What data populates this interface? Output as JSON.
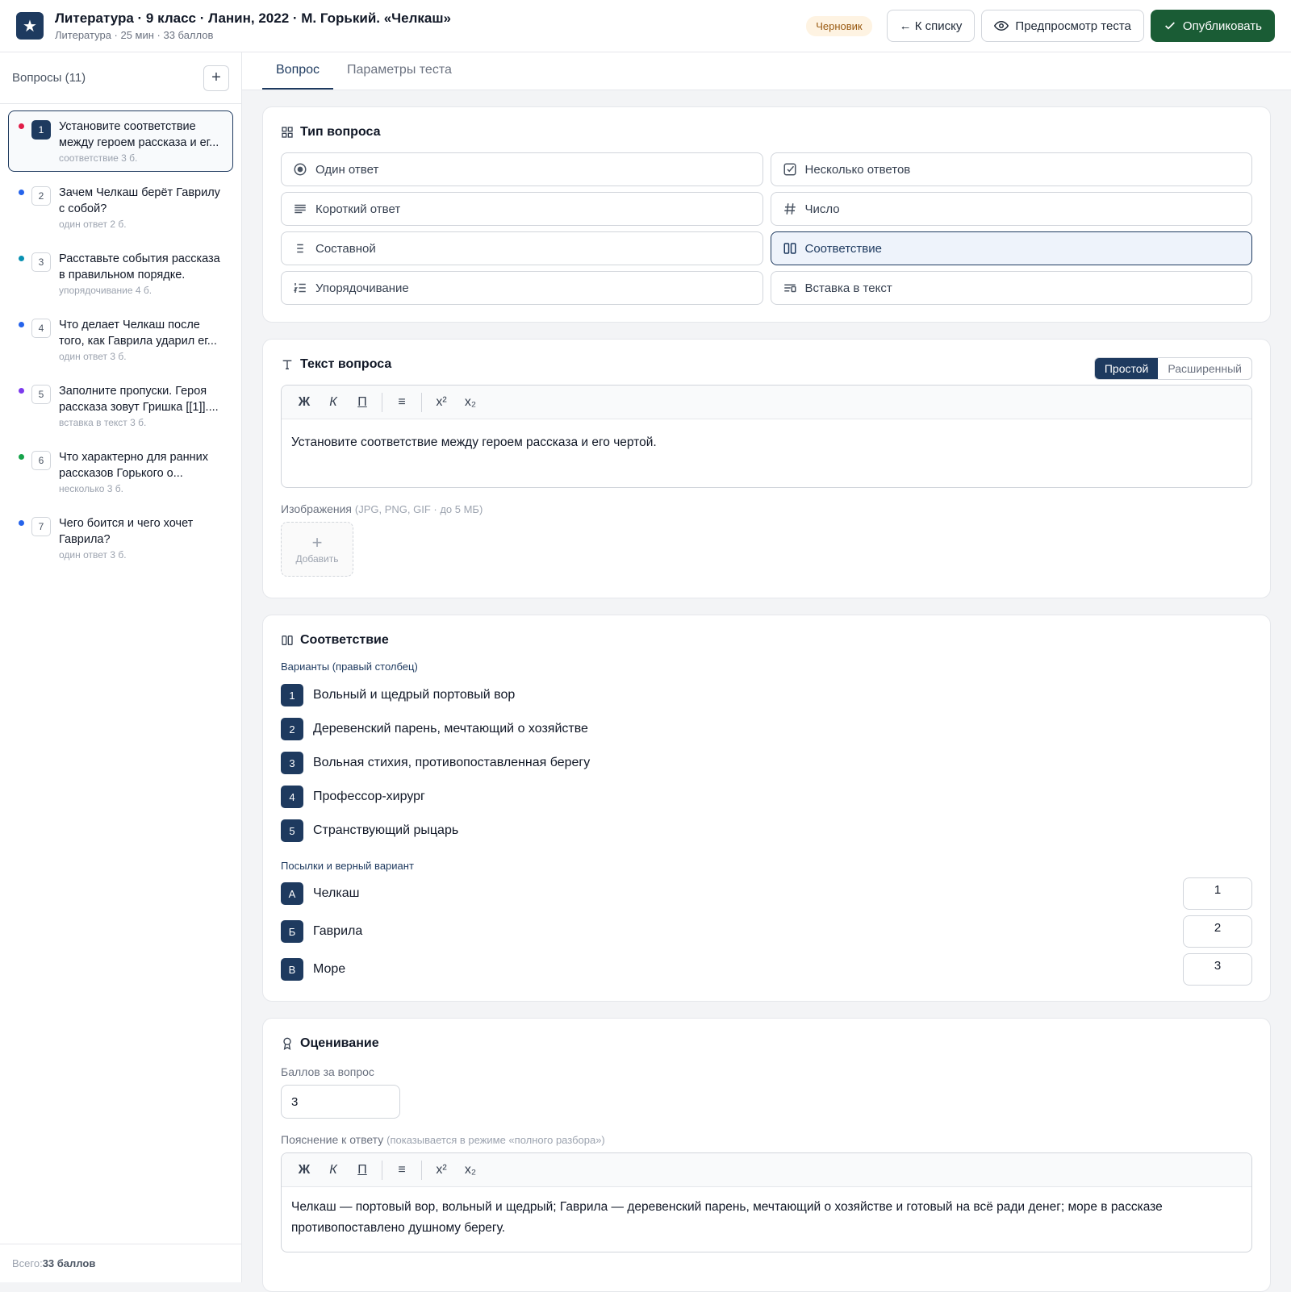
{
  "header": {
    "logo_glyph": "★",
    "title": "Литература · 9 класс · Ланин, 2022 · М. Горький. «Челкаш»",
    "subtitle": "Литература · 25 мин · 33 баллов",
    "status_badge": "Черновик",
    "back_label": "← К списку",
    "preview_label": "Предпросмотр теста",
    "publish_label": "Опубликовать"
  },
  "sidebar": {
    "title": "Вопросы (11)",
    "add_glyph": "+",
    "items": [
      {
        "num": "1",
        "text": "Установите соответствие между героем рассказа и ег...",
        "meta": "соответствие  3 б.",
        "dot": "#e11d48"
      },
      {
        "num": "2",
        "text": "Зачем Челкаш берёт Гаврилу с собой?",
        "meta": "один ответ  2 б.",
        "dot": "#2563eb"
      },
      {
        "num": "3",
        "text": "Расставьте события рассказа в правильном порядке.",
        "meta": "упорядочивание  4 б.",
        "dot": "#0891b2"
      },
      {
        "num": "4",
        "text": "Что делает Челкаш после того, как Гаврила ударил ег...",
        "meta": "один ответ  3 б.",
        "dot": "#2563eb"
      },
      {
        "num": "5",
        "text": "Заполните пропуски. Героя рассказа зовут Гришка [[1]]....",
        "meta": "вставка в текст  3 б.",
        "dot": "#7c3aed"
      },
      {
        "num": "6",
        "text": "Что характерно для ранних рассказов Горького о...",
        "meta": "несколько  3 б.",
        "dot": "#16a34a"
      },
      {
        "num": "7",
        "text": "Чего боится и чего хочет Гаврила?",
        "meta": "один ответ  3 б.",
        "dot": "#2563eb"
      }
    ],
    "footer_prefix": "Всего: ",
    "footer_total": "33 баллов"
  },
  "tabs": [
    "Вопрос",
    "Параметры теста"
  ],
  "question_type": {
    "title": "Тип вопроса",
    "types": [
      {
        "label": "Один ответ",
        "icon": "radio-icon"
      },
      {
        "label": "Несколько ответов",
        "icon": "checkbox-icon"
      },
      {
        "label": "Короткий ответ",
        "icon": "lines-icon"
      },
      {
        "label": "Число",
        "icon": "hash-icon"
      },
      {
        "label": "Составной",
        "icon": "list-icon"
      },
      {
        "label": "Соответствие",
        "icon": "columns-icon"
      },
      {
        "label": "Упорядочивание",
        "icon": "ordered-list-icon"
      },
      {
        "label": "Вставка в текст",
        "icon": "insert-text-icon"
      }
    ],
    "selected": "Соответствие"
  },
  "question_text": {
    "title": "Текст вопроса",
    "mode_simple": "Простой",
    "mode_advanced": "Расширенный",
    "toolbar": {
      "bold": "Ж",
      "italic": "К",
      "underline": "П",
      "list": "≡",
      "sup": "x²",
      "sub": "x₂"
    },
    "body": "Установите соответствие между героем рассказа и его чертой.",
    "images_label": "Изображения",
    "images_hint": "(JPG, PNG, GIF · до 5 МБ)",
    "add_glyph": "+",
    "add_label": "Добавить"
  },
  "matching": {
    "title": "Соответствие",
    "options_label": "Варианты (правый столбец)",
    "options": [
      {
        "num": "1",
        "text": "Вольный и щедрый портовый вор"
      },
      {
        "num": "2",
        "text": "Деревенский парень, мечтающий о хозяйстве"
      },
      {
        "num": "3",
        "text": "Вольная стихия, противопоставленная берегу"
      },
      {
        "num": "4",
        "text": "Профессор-хирург"
      },
      {
        "num": "5",
        "text": "Странствующий рыцарь"
      }
    ],
    "premises_label": "Посылки и верный вариант",
    "premises": [
      {
        "letter": "А",
        "text": "Челкаш",
        "answer": "1"
      },
      {
        "letter": "Б",
        "text": "Гаврила",
        "answer": "2"
      },
      {
        "letter": "В",
        "text": "Море",
        "answer": "3"
      }
    ]
  },
  "grading": {
    "title": "Оценивание",
    "points_label": "Баллов за вопрос",
    "points_value": "3",
    "explanation_label": "Пояснение к ответу",
    "explanation_hint": "(показывается в режиме «полного разбора»)",
    "explanation_body": "Челкаш — портовый вор, вольный и щедрый; Гаврила — деревенский парень, мечтающий о хозяйстве и готовый на всё ради денег; море в рассказе противопоставлено душному берегу."
  },
  "colors": {
    "primary": "#1e3a5f",
    "publish": "#1a5c35",
    "badge_bg": "#fef3e2"
  }
}
